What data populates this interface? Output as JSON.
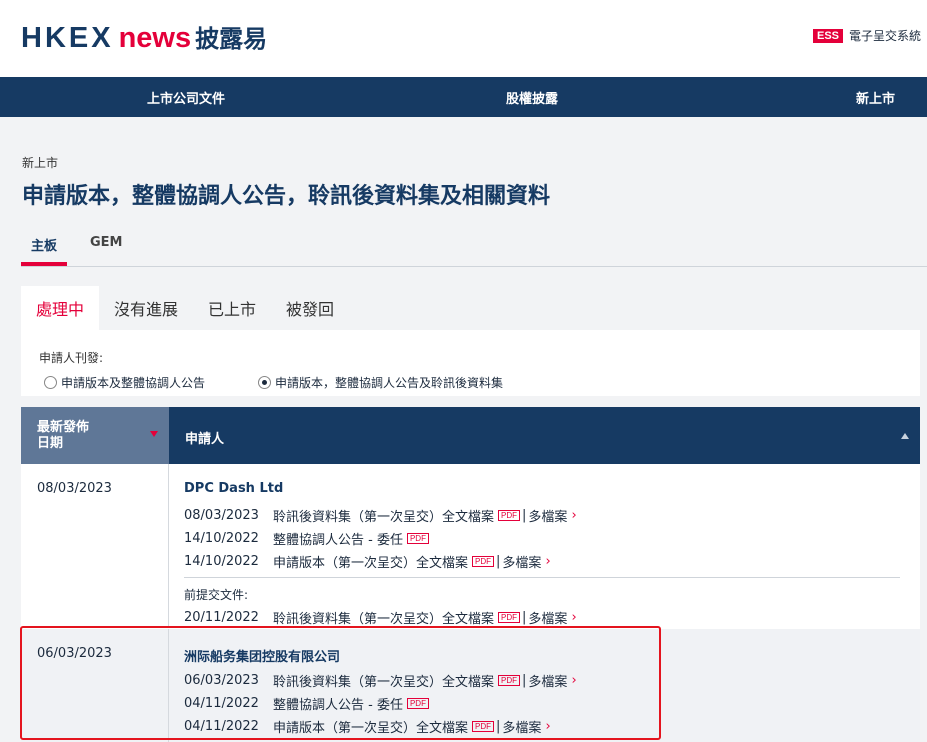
{
  "header": {
    "logo_hkex": "HKEX",
    "logo_news": "news",
    "logo_cn": "披露易",
    "ess_badge": "ESS",
    "ess_label": "電子呈交系統"
  },
  "nav": [
    "上市公司文件",
    "股權披露",
    "新上市"
  ],
  "breadcrumb": "新上市",
  "page_title": "申請版本，整體協調人公告，聆訊後資料集及相關資料",
  "board_tabs": [
    "主板",
    "GEM"
  ],
  "status_tabs": [
    "處理中",
    "沒有進展",
    "已上市",
    "被發回"
  ],
  "filter": {
    "label": "申請人刊發:",
    "options": [
      "申請版本及整體協調人公告",
      "申請版本，整體協調人公告及聆訊後資料集"
    ],
    "selected": 1
  },
  "table": {
    "col_date": "最新發佈日期",
    "col_date_line1": "最新發佈",
    "col_date_line2": "日期",
    "col_applicant": "申請人",
    "pdf_label": "PDF",
    "rows": [
      {
        "date": "08/03/2023",
        "applicant": "DPC Dash Ltd",
        "docs": [
          {
            "date": "08/03/2023",
            "title": "聆訊後資料集（第一次呈交）",
            "full": "全文檔案",
            "pdf": true,
            "multi": "多檔案"
          },
          {
            "date": "14/10/2022",
            "title": "整體協調人公告 - 委任",
            "full": "",
            "pdf": true,
            "multi": ""
          },
          {
            "date": "14/10/2022",
            "title": "申請版本（第一次呈交）",
            "full": "全文檔案",
            "pdf": true,
            "multi": "多檔案"
          }
        ],
        "prior_label": "前提交文件:",
        "prior_docs": [
          {
            "date": "20/11/2022",
            "title": "聆訊後資料集（第一次呈交）",
            "full": "全文檔案",
            "pdf": true,
            "multi": "多檔案"
          }
        ]
      },
      {
        "date": "06/03/2023",
        "applicant": "洲际船务集团控股有限公司",
        "docs": [
          {
            "date": "06/03/2023",
            "title": "聆訊後資料集（第一次呈交）",
            "full": "全文檔案",
            "pdf": true,
            "multi": "多檔案"
          },
          {
            "date": "04/11/2022",
            "title": "整體協調人公告 - 委任",
            "full": "",
            "pdf": true,
            "multi": ""
          },
          {
            "date": "04/11/2022",
            "title": "申請版本（第一次呈交）",
            "full": "全文檔案",
            "pdf": true,
            "multi": "多檔案"
          }
        ]
      }
    ]
  },
  "colors": {
    "brand_navy": "#163a63",
    "brand_red": "#e4003a",
    "header_date_col": "#5f7797",
    "highlight_box": "#e4141e"
  }
}
